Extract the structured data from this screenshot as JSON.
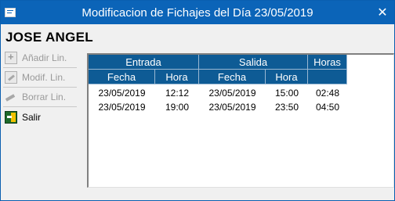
{
  "window": {
    "title": "Modificacion de Fichajes del Día 23/05/2019",
    "close_glyph": "✕"
  },
  "person": {
    "name": "JOSE ANGEL"
  },
  "sidebar": {
    "items": [
      {
        "label": "Añadir Lin.",
        "enabled": false,
        "icon": "add-line-icon"
      },
      {
        "label": "Modif. Lin.",
        "enabled": false,
        "icon": "edit-line-icon"
      },
      {
        "label": "Borrar Lin.",
        "enabled": false,
        "icon": "eraser-icon"
      },
      {
        "label": "Salir",
        "enabled": true,
        "icon": "exit-door-icon"
      }
    ]
  },
  "table": {
    "groups": {
      "entrada": "Entrada",
      "salida": "Salida",
      "horas": "Horas"
    },
    "columns": {
      "fecha_entrada": "Fecha",
      "hora_entrada": "Hora",
      "fecha_salida": "Fecha",
      "hora_salida": "Hora"
    },
    "rows": [
      {
        "fecha_entrada": "23/05/2019",
        "hora_entrada": "12:12",
        "fecha_salida": "23/05/2019",
        "hora_salida": "15:00",
        "horas": "02:48"
      },
      {
        "fecha_entrada": "23/05/2019",
        "hora_entrada": "19:00",
        "fecha_salida": "23/05/2019",
        "hora_salida": "23:50",
        "horas": "04:50"
      }
    ]
  },
  "colors": {
    "titlebar": "#0b64b8",
    "header": "#0e5b95"
  }
}
